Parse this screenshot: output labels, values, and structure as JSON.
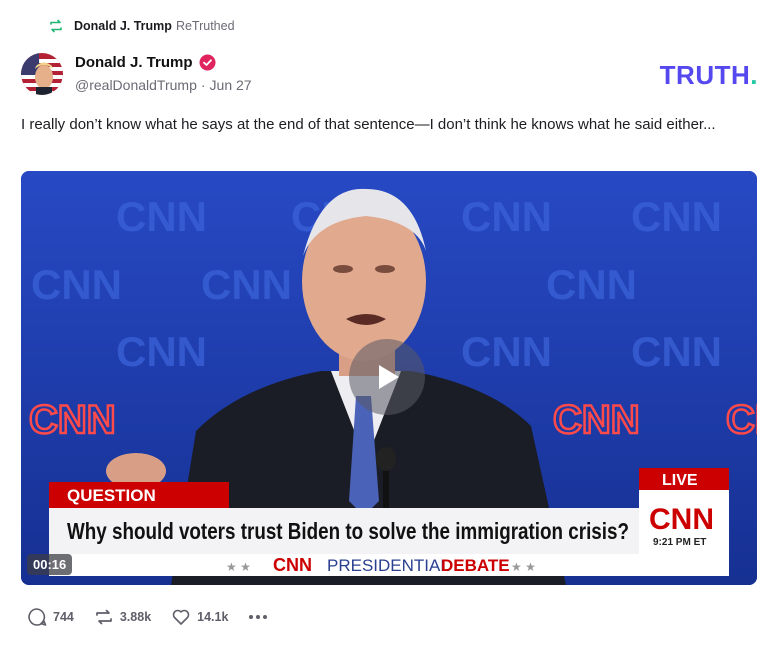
{
  "retruth": {
    "name": "Donald J. Trump",
    "label": "ReTruthed"
  },
  "author": {
    "name": "Donald J. Trump",
    "handle": "@realDonaldTrump",
    "separator": "·",
    "date": "Jun 27"
  },
  "brand": {
    "word": "TRUTH",
    "dot": "."
  },
  "post": {
    "text": "I really don’t know what he says at the end of that sentence—I don’t think he knows what he said either..."
  },
  "video": {
    "timecode": "00:16",
    "chyron": {
      "tag": "QUESTION",
      "headline": "Why should voters trust Biden to solve the immigration crisis?",
      "network": "CNN",
      "program": "PRESIDENTIAL",
      "program_bold": "DEBATE",
      "live": "LIVE",
      "time": "9:21 PM ET"
    },
    "background_word": "CNN"
  },
  "actions": {
    "replies": "744",
    "retruths": "3.88k",
    "likes": "14.1k"
  },
  "colors": {
    "brand": "#5448ee",
    "brand_dot": "#22c9a6",
    "retruth_green": "#22b573",
    "verified": "#e0245e",
    "cnn_red": "#cc0000"
  }
}
